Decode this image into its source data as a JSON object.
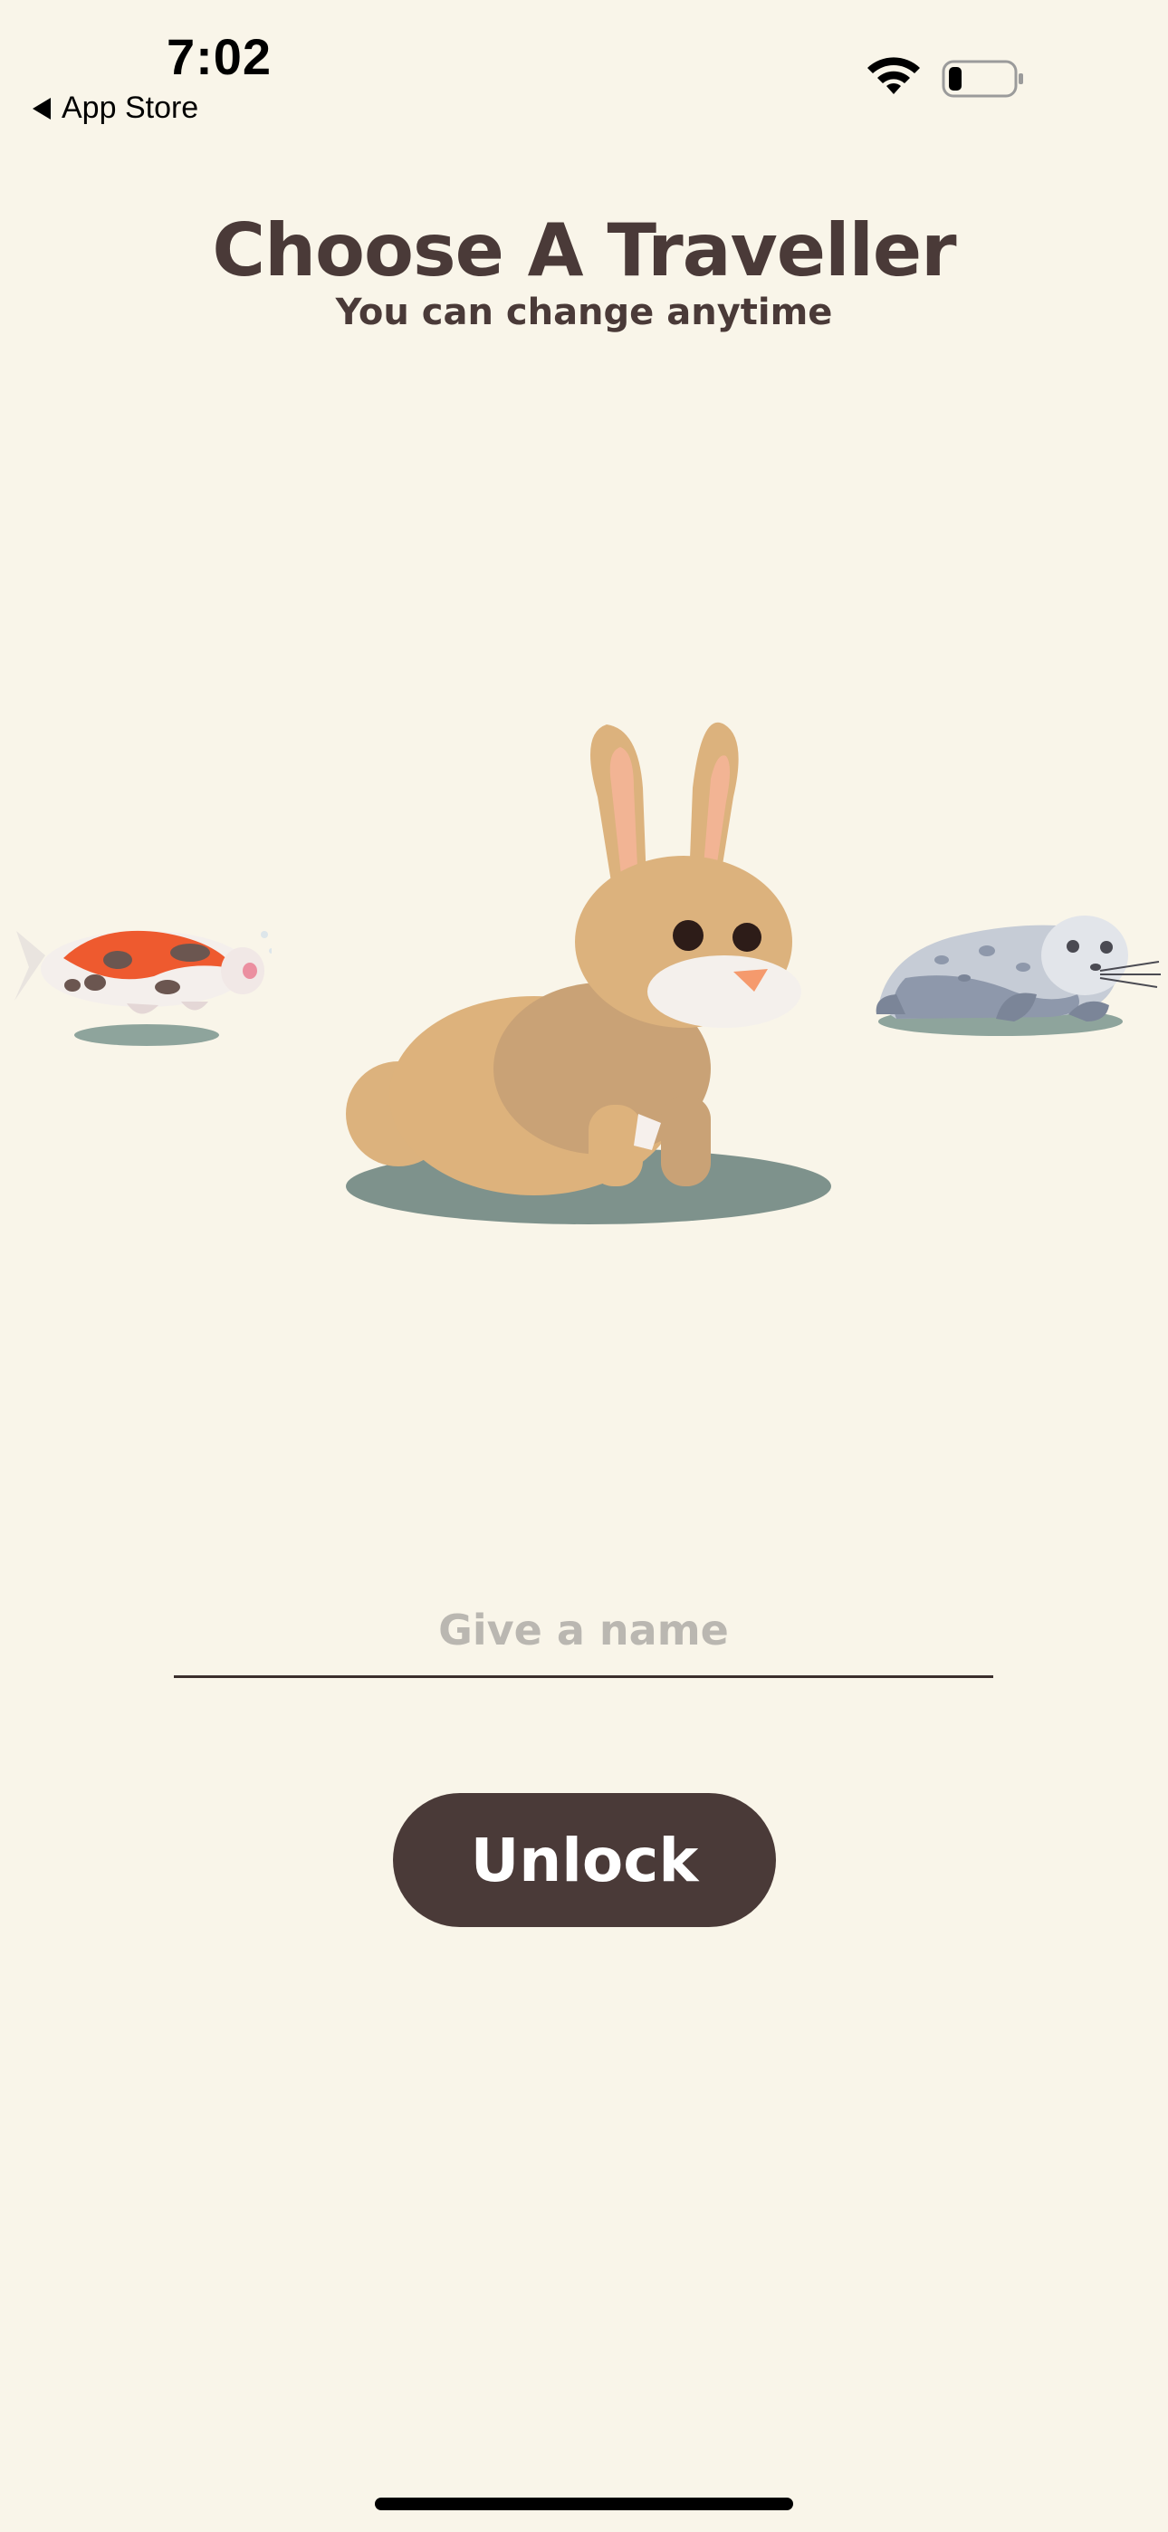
{
  "status_bar": {
    "time": "7:02",
    "back_label": "App Store",
    "wifi_icon": "wifi-icon",
    "battery_icon": "battery-icon"
  },
  "header": {
    "title": "Choose A Traveller",
    "subtitle": "You can change anytime"
  },
  "carousel": {
    "items": [
      {
        "name": "koi",
        "icon": "koi-fish-icon",
        "selected": false
      },
      {
        "name": "rabbit",
        "icon": "rabbit-icon",
        "selected": true
      },
      {
        "name": "seal",
        "icon": "seal-icon",
        "selected": false
      }
    ]
  },
  "form": {
    "name_placeholder": "Give a name",
    "name_value": ""
  },
  "actions": {
    "unlock_label": "Unlock"
  },
  "colors": {
    "background": "#f9f5e9",
    "text_primary": "#4a3a38",
    "button_bg": "#4a3a38",
    "placeholder": "#bab7b1",
    "shadow": "#7e928c"
  }
}
